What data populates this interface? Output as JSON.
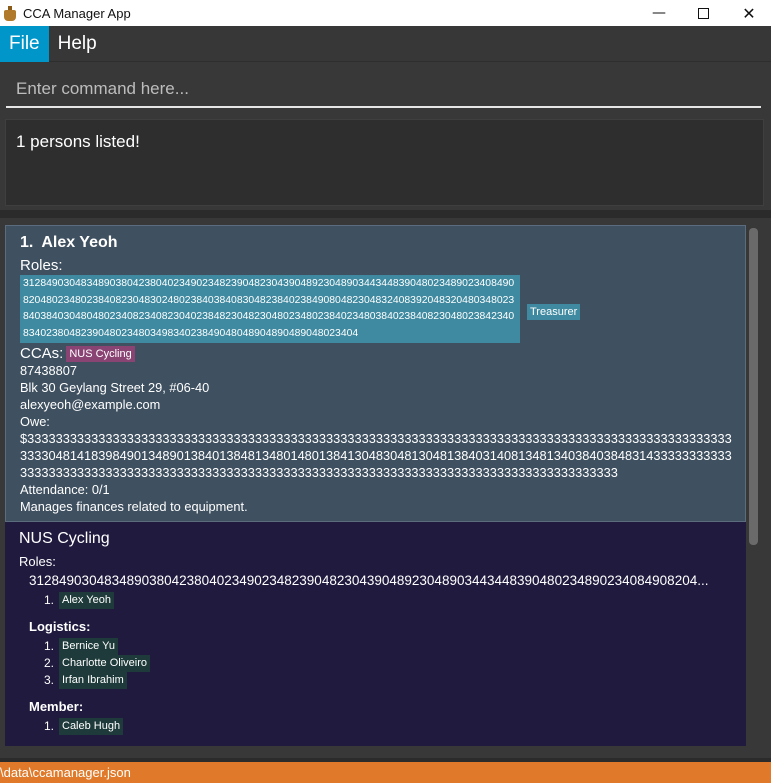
{
  "window": {
    "title": "CCA Manager App",
    "controls": {
      "minimize": "—",
      "maximize": "□",
      "close": "✕"
    },
    "icon": "app-icon"
  },
  "menu": {
    "file": "File",
    "help": "Help"
  },
  "command": {
    "placeholder": "Enter command here..."
  },
  "result": {
    "message": "1 persons listed!"
  },
  "person": {
    "index": "1.",
    "name": "Alex Yeoh",
    "roles_label": "Roles:",
    "roles": [
      "3128490304834890380423804023490234823904823043904892304890344344839048023489023408490820480234802384082304830248023840384083048238402384908048230483240839204832048034802384038403048048023408234082304023848230482304802348023840234803840238408230480238423408340238048239048023480349834023849048048904890489048023404",
      "Treasurer"
    ],
    "ccas_label": "CCAs:",
    "ccas": [
      "NUS Cycling"
    ],
    "phone": "87438807",
    "address": "Blk 30 Geylang Street 29, #06-40",
    "email": "alexyeoh@example.com",
    "owe_label": "Owe:",
    "owe_value": "$3333333333333333333333333333333333333333333333333333333333333333333333333333333333333333333333333333333048141839849013489013840138481348014801384130483048130481384031408134813403840384831433333333333333333333333333333333333333333333333333333333333333333333333333333333333333333333333",
    "attendance": "Attendance: 0/1",
    "remark": "Manages finances related to equipment."
  },
  "cca": {
    "name": "NUS Cycling",
    "roles_label": "Roles:",
    "groups": [
      {
        "role": "31284903048348903804238040234902348239048230439048923048903443448390480234890234084908204...",
        "members": [
          {
            "num": "1.",
            "name": "Alex Yeoh"
          }
        ]
      },
      {
        "role": "Logistics:",
        "members": [
          {
            "num": "1.",
            "name": "Bernice Yu"
          },
          {
            "num": "2.",
            "name": "Charlotte Oliveiro"
          },
          {
            "num": "3.",
            "name": "Irfan Ibrahim"
          }
        ]
      },
      {
        "role": "Member:",
        "members": [
          {
            "num": "1.",
            "name": "Caleb Hugh"
          }
        ]
      }
    ]
  },
  "status": {
    "path": "\\data\\ccamanager.json"
  },
  "colors": {
    "menu_active": "#0096c9",
    "role_tag": "#3f8aa0",
    "cca_tag": "#8a4474",
    "person_card": "#3f5060",
    "cca_card": "#211a3f",
    "statusbar": "#e07a2a"
  }
}
